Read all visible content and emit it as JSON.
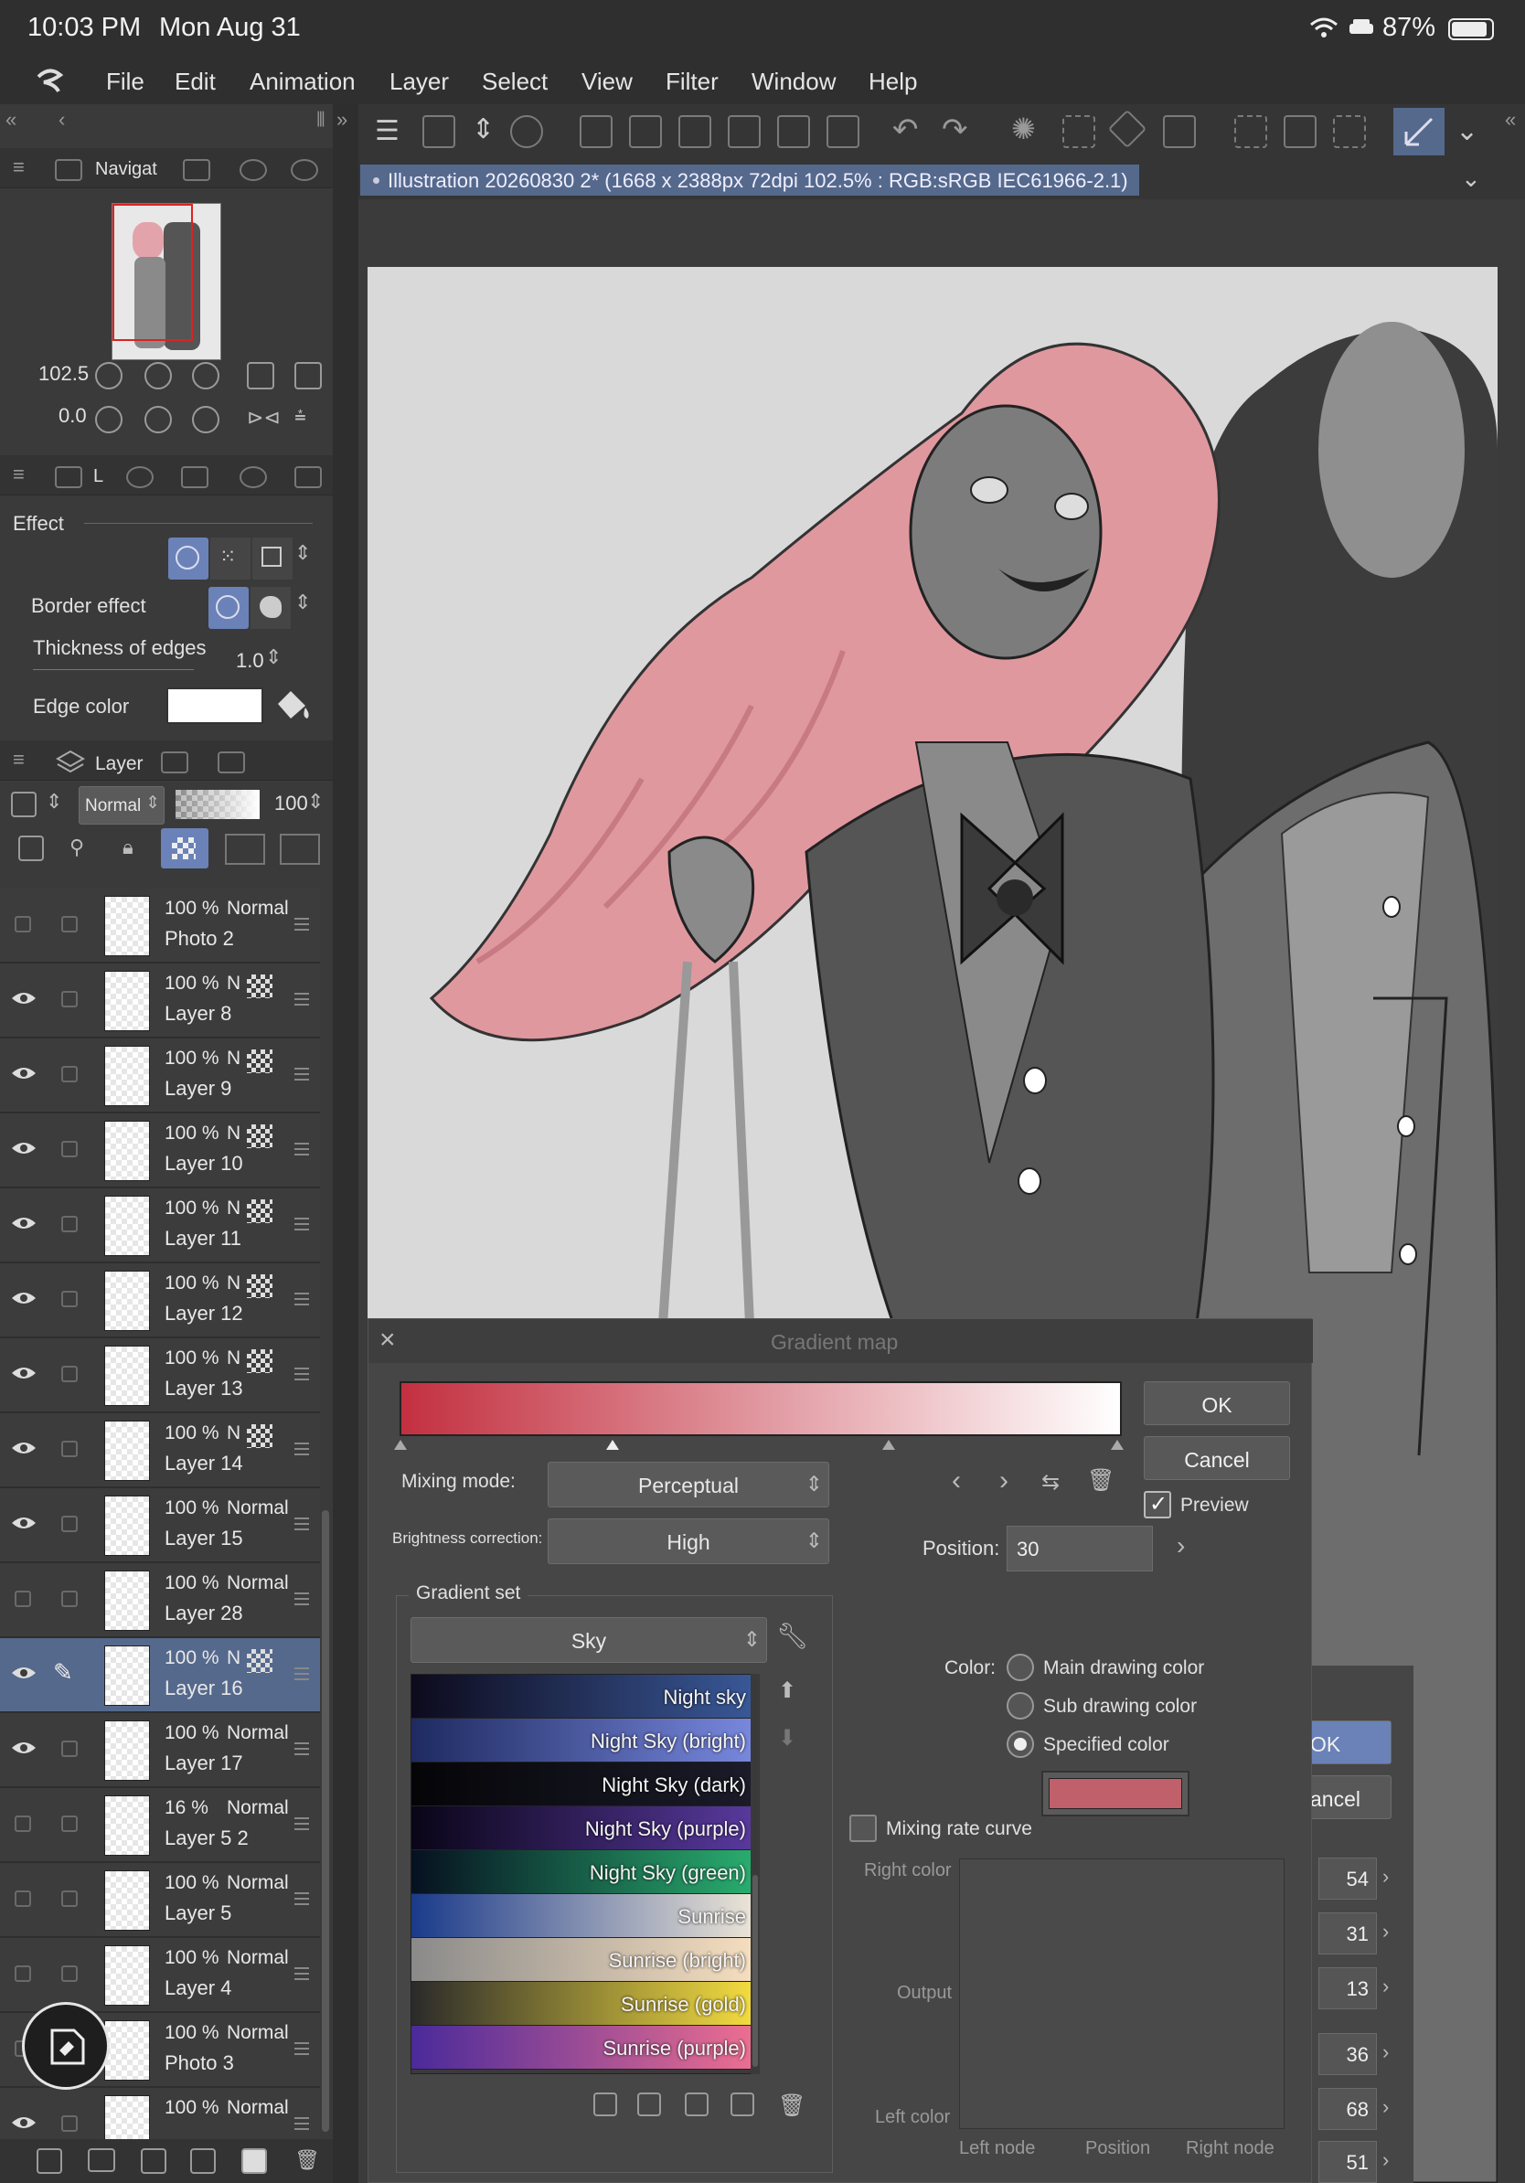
{
  "status": {
    "time": "10:03 PM",
    "date": "Mon Aug 31",
    "battery": "87%"
  },
  "menu": [
    "File",
    "Edit",
    "Animation",
    "Layer",
    "Select",
    "View",
    "Filter",
    "Window",
    "Help"
  ],
  "navigator": {
    "tab_label": "Navigat",
    "zoom": "102.5",
    "rotation": "0.0"
  },
  "property": {
    "tab_label": "L",
    "effect_label": "Effect",
    "border_effect_label": "Border effect",
    "thickness_label": "Thickness of edges",
    "thickness_value": "1.0",
    "edge_color_label": "Edge color",
    "edge_color": "#ffffff"
  },
  "layer_panel": {
    "tab_label": "Layer",
    "blend_mode": "Normal",
    "opacity": "100",
    "layers": [
      {
        "pct": "100 %",
        "mode": "Normal",
        "name": "Photo 2",
        "visible": false,
        "selected": false,
        "masked": false
      },
      {
        "pct": "100 %",
        "mode": "N",
        "name": "Layer 8",
        "visible": true,
        "selected": false,
        "masked": true
      },
      {
        "pct": "100 %",
        "mode": "N",
        "name": "Layer 9",
        "visible": true,
        "selected": false,
        "masked": true
      },
      {
        "pct": "100 %",
        "mode": "N",
        "name": "Layer 10",
        "visible": true,
        "selected": false,
        "masked": true
      },
      {
        "pct": "100 %",
        "mode": "N",
        "name": "Layer 11",
        "visible": true,
        "selected": false,
        "masked": true
      },
      {
        "pct": "100 %",
        "mode": "N",
        "name": "Layer 12",
        "visible": true,
        "selected": false,
        "masked": true
      },
      {
        "pct": "100 %",
        "mode": "N",
        "name": "Layer 13",
        "visible": true,
        "selected": false,
        "masked": true
      },
      {
        "pct": "100 %",
        "mode": "N",
        "name": "Layer 14",
        "visible": true,
        "selected": false,
        "masked": true
      },
      {
        "pct": "100 %",
        "mode": "Normal",
        "name": "Layer 15",
        "visible": true,
        "selected": false,
        "masked": false
      },
      {
        "pct": "100 %",
        "mode": "Normal",
        "name": "Layer 28",
        "visible": false,
        "selected": false,
        "masked": false
      },
      {
        "pct": "100 %",
        "mode": "N",
        "name": "Layer 16",
        "visible": true,
        "selected": true,
        "masked": true
      },
      {
        "pct": "100 %",
        "mode": "Normal",
        "name": "Layer 17",
        "visible": true,
        "selected": false,
        "masked": false
      },
      {
        "pct": "16 %",
        "mode": "Normal",
        "name": "Layer 5 2",
        "visible": false,
        "selected": false,
        "masked": false
      },
      {
        "pct": "100 %",
        "mode": "Normal",
        "name": "Layer 5",
        "visible": false,
        "selected": false,
        "masked": false
      },
      {
        "pct": "100 %",
        "mode": "Normal",
        "name": "Layer 4",
        "visible": false,
        "selected": false,
        "masked": false
      },
      {
        "pct": "100 %",
        "mode": "Normal",
        "name": "Photo 3",
        "visible": false,
        "selected": false,
        "masked": false
      },
      {
        "pct": "100 %",
        "mode": "Normal",
        "name": "",
        "visible": true,
        "selected": false,
        "masked": false
      }
    ]
  },
  "document": {
    "title": "Illustration 20260830 2* (1668 x 2388px 72dpi 102.5% : RGB:sRGB IEC61966-2.1)"
  },
  "gradient_map": {
    "title": "Gradient map",
    "ok": "OK",
    "cancel": "Cancel",
    "preview_label": "Preview",
    "mixing_mode_label": "Mixing mode:",
    "mixing_mode": "Perceptual",
    "brightness_label": "Brightness correction:",
    "brightness": "High",
    "position_label": "Position:",
    "position": "30",
    "gradient_set_label": "Gradient set",
    "gradient_set": "Sky",
    "gradient_start": "#c33040",
    "gradient_end": "#ffffff",
    "presets": [
      {
        "name": "Night sky",
        "from": "#0d0a1c",
        "to": "#3a5a9a"
      },
      {
        "name": "Night Sky (bright)",
        "from": "#1e2a60",
        "to": "#7a8ae0"
      },
      {
        "name": "Night Sky (dark)",
        "from": "#050508",
        "to": "#1c1c2a"
      },
      {
        "name": "Night Sky (purple)",
        "from": "#0a0518",
        "to": "#5a3aa0"
      },
      {
        "name": "Night Sky (green)",
        "from": "#061020",
        "to": "#2ab070"
      },
      {
        "name": "Sunrise",
        "from": "#1a3a8a",
        "to": "#f0e8d8"
      },
      {
        "name": "Sunrise (bright)",
        "from": "#8a8a8a",
        "to": "#f8e0c0"
      },
      {
        "name": "Sunrise (gold)",
        "from": "#2a2a2a",
        "to": "#f8e040"
      },
      {
        "name": "Sunrise (purple)",
        "from": "#4a2a9a",
        "to": "#f07090"
      }
    ],
    "color_label": "Color:",
    "color_options": [
      "Main drawing color",
      "Sub drawing color",
      "Specified color"
    ],
    "specified_color": "#c0606a",
    "mixing_rate_curve_label": "Mixing rate curve",
    "right_color_label": "Right color",
    "output_label": "Output",
    "left_color_label": "Left color",
    "left_node_label": "Left node",
    "position_col_label": "Position",
    "right_node_label": "Right node"
  },
  "bg_dialog": {
    "ok_fragment": "OK",
    "cancel_fragment": "ancel",
    "values": [
      "54",
      "31",
      "13",
      "36",
      "68",
      "51"
    ]
  }
}
